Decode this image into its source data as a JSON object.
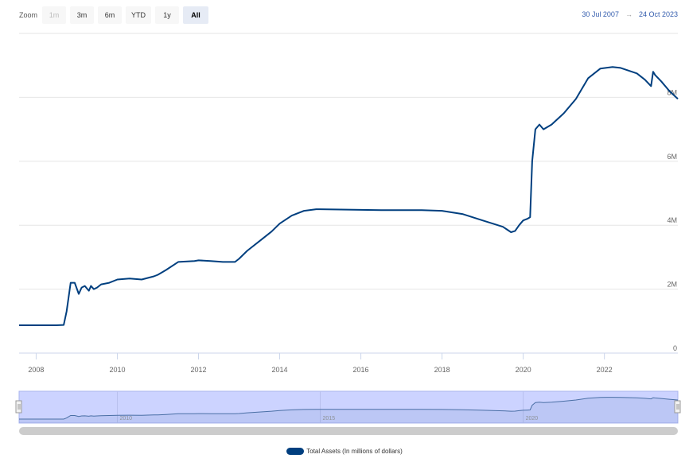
{
  "zoom": {
    "label": "Zoom",
    "buttons": [
      {
        "label": "1m",
        "state": "disabled"
      },
      {
        "label": "3m",
        "state": "normal"
      },
      {
        "label": "6m",
        "state": "normal"
      },
      {
        "label": "YTD",
        "state": "normal"
      },
      {
        "label": "1y",
        "state": "normal"
      },
      {
        "label": "All",
        "state": "active"
      }
    ]
  },
  "range": {
    "from": "30 Jul 2007",
    "arrow": "→",
    "to": "24 Oct 2023"
  },
  "colors": {
    "series": "#003f7f",
    "navigator_fill": "#ccd3ff",
    "range_text": "#335cad"
  },
  "chart_data": {
    "type": "line",
    "xlabel": "",
    "ylabel": "",
    "xlim": [
      2007.58,
      2023.81
    ],
    "ylim": [
      0,
      10
    ],
    "y_unit": "M",
    "y_ticks": [
      {
        "v": 0,
        "label": "0"
      },
      {
        "v": 2,
        "label": "2M"
      },
      {
        "v": 4,
        "label": "4M"
      },
      {
        "v": 6,
        "label": "6M"
      },
      {
        "v": 8,
        "label": "8M"
      }
    ],
    "x_ticks": [
      "2008",
      "2010",
      "2012",
      "2014",
      "2016",
      "2018",
      "2020",
      "2022"
    ],
    "navigator_ticks": [
      "2010",
      "2015",
      "2020"
    ],
    "series": [
      {
        "name": "Total Assets (In millions of dollars)",
        "x": [
          2007.58,
          2008.0,
          2008.5,
          2008.68,
          2008.75,
          2008.85,
          2008.95,
          2009.05,
          2009.12,
          2009.2,
          2009.3,
          2009.35,
          2009.42,
          2009.5,
          2009.6,
          2009.8,
          2010.0,
          2010.3,
          2010.6,
          2010.9,
          2011.0,
          2011.2,
          2011.5,
          2011.9,
          2012.0,
          2012.3,
          2012.6,
          2012.9,
          2013.0,
          2013.2,
          2013.5,
          2013.8,
          2014.0,
          2014.3,
          2014.6,
          2014.9,
          2015.0,
          2015.5,
          2016.0,
          2016.5,
          2017.0,
          2017.5,
          2018.0,
          2018.5,
          2019.0,
          2019.5,
          2019.7,
          2019.8,
          2019.9,
          2020.0,
          2020.1,
          2020.17,
          2020.22,
          2020.3,
          2020.4,
          2020.5,
          2020.7,
          2021.0,
          2021.3,
          2021.6,
          2021.9,
          2022.2,
          2022.4,
          2022.8,
          2023.0,
          2023.15,
          2023.2,
          2023.25,
          2023.4,
          2023.6,
          2023.81
        ],
        "values": [
          0.87,
          0.87,
          0.87,
          0.88,
          1.3,
          2.2,
          2.2,
          1.85,
          2.05,
          2.1,
          1.95,
          2.1,
          2.0,
          2.05,
          2.15,
          2.2,
          2.3,
          2.33,
          2.3,
          2.4,
          2.45,
          2.6,
          2.85,
          2.88,
          2.9,
          2.88,
          2.85,
          2.85,
          2.95,
          3.2,
          3.5,
          3.8,
          4.05,
          4.3,
          4.45,
          4.5,
          4.5,
          4.49,
          4.48,
          4.47,
          4.47,
          4.47,
          4.45,
          4.35,
          4.15,
          3.95,
          3.78,
          3.82,
          4.0,
          4.15,
          4.2,
          4.25,
          6.0,
          7.0,
          7.15,
          7.0,
          7.15,
          7.5,
          7.95,
          8.6,
          8.9,
          8.95,
          8.92,
          8.75,
          8.55,
          8.35,
          8.8,
          8.7,
          8.5,
          8.2,
          7.95
        ]
      }
    ],
    "legend_position": "bottom-center",
    "grid": "horizontal"
  }
}
